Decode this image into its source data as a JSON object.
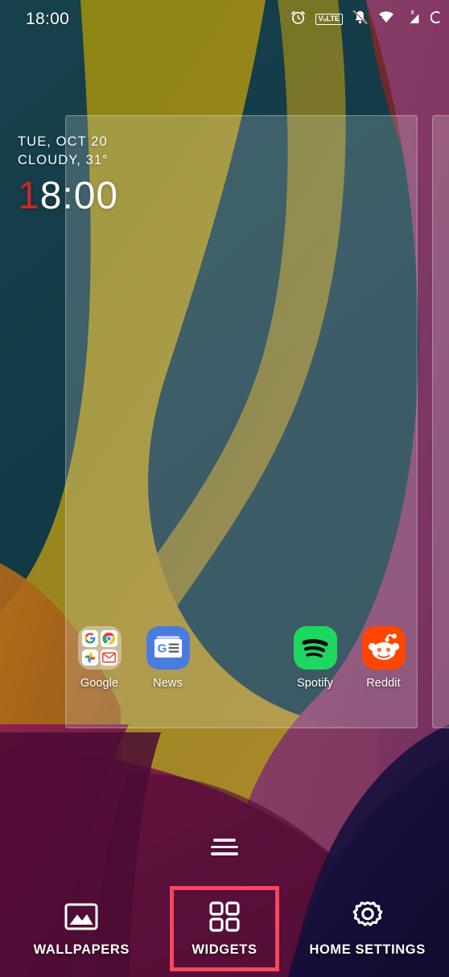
{
  "status_bar": {
    "time": "18:00",
    "icons": [
      {
        "name": "alarm-icon",
        "label": "alarm"
      },
      {
        "name": "volte-icon",
        "label": "VₒLTE"
      },
      {
        "name": "notifications-muted-icon",
        "label": "silent"
      },
      {
        "name": "wifi-icon",
        "label": "wifi"
      },
      {
        "name": "mobile-signal-off-icon",
        "label": "no signal"
      },
      {
        "name": "battery-icon",
        "label": "battery"
      }
    ]
  },
  "clock_widget": {
    "date": "TUE, OCT 20",
    "weather": "CLOUDY, 31°",
    "time_accent": "1",
    "time_rest": "8:00",
    "accent_color": "#c62828"
  },
  "apps": [
    {
      "label": "Google",
      "type": "folder",
      "icon_name": "google-folder-icon",
      "mini": [
        {
          "name": "google-search-icon",
          "glyph": "G",
          "bg": "#ffffff",
          "fg": "#4285f4"
        },
        {
          "name": "chrome-icon",
          "glyph": "",
          "bg": "#ffffff",
          "fg": "#1a73e8"
        },
        {
          "name": "google-photos-icon",
          "glyph": "",
          "bg": "#ffffff",
          "fg": "#fbbc04"
        },
        {
          "name": "gmail-icon",
          "glyph": "",
          "bg": "#ea4335",
          "fg": "#ffffff"
        }
      ]
    },
    {
      "label": "News",
      "type": "app",
      "icon_name": "google-news-icon",
      "bg": "#4a7ce0",
      "fg": "#ffffff"
    },
    {
      "label": "Spotify",
      "type": "app",
      "icon_name": "spotify-icon",
      "bg": "#1ed760",
      "fg": "#000000"
    },
    {
      "label": "Reddit",
      "type": "app",
      "icon_name": "reddit-icon",
      "bg": "#ff4500",
      "fg": "#ffffff"
    }
  ],
  "page_indicator": {
    "name": "home-screen-page-indicator",
    "pages": 3,
    "current": 1
  },
  "bottom_actions": {
    "highlight_color": "#f5485c",
    "selected": "WIDGETS",
    "items": [
      {
        "label": "WALLPAPERS",
        "icon_name": "image-icon",
        "selected": false
      },
      {
        "label": "WIDGETS",
        "icon_name": "widgets-grid-icon",
        "selected": true
      },
      {
        "label": "HOME SETTINGS",
        "icon_name": "gear-icon",
        "selected": false
      }
    ]
  },
  "wallpaper": {
    "name": "abstract-curves-wallpaper",
    "colors": {
      "teal": "#12414c",
      "olive": "#8a8211",
      "maroon": "#6e2a24",
      "gold": "#b08a2e",
      "orange": "#a8621a",
      "plum": "#8b3f6e",
      "magenta": "#7d1f4d",
      "deep_purple": "#4a0c34",
      "navy": "#15103a"
    }
  }
}
